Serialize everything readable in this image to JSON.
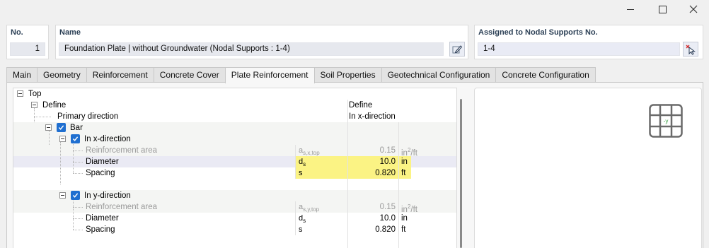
{
  "header": {
    "no": {
      "label": "No.",
      "value": "1"
    },
    "name": {
      "label": "Name",
      "value": "Foundation Plate | without Groundwater (Nodal Supports : 1-4)"
    },
    "assigned": {
      "label": "Assigned to Nodal Supports No.",
      "value": "1-4"
    }
  },
  "tabs": [
    {
      "label": "Main",
      "active": false
    },
    {
      "label": "Geometry",
      "active": false
    },
    {
      "label": "Reinforcement",
      "active": false
    },
    {
      "label": "Concrete Cover",
      "active": false
    },
    {
      "label": "Plate Reinforcement",
      "active": true
    },
    {
      "label": "Soil Properties",
      "active": false
    },
    {
      "label": "Geotechnical Configuration",
      "active": false
    },
    {
      "label": "Concrete Configuration",
      "active": false
    }
  ],
  "tree": {
    "top": "Top",
    "define": {
      "label": "Define",
      "value": "Define"
    },
    "primary_direction": {
      "label": "Primary direction",
      "value": "In x-direction"
    },
    "bar": {
      "label": "Bar",
      "checked": true
    },
    "x_direction": {
      "label": "In x-direction",
      "checked": true,
      "area": {
        "label": "Reinforcement area",
        "symbol": "a",
        "symbol_sub": "s,x,top",
        "value": "0.15",
        "unit": "in",
        "unit_sup": "2",
        "unit_rest": "/ft"
      },
      "diameter": {
        "label": "Diameter",
        "symbol": "d",
        "symbol_sub": "s",
        "value": "10.0",
        "unit": "in"
      },
      "spacing": {
        "label": "Spacing",
        "symbol": "s",
        "value": "0.820",
        "unit": "ft"
      }
    },
    "y_direction": {
      "label": "In y-direction",
      "checked": true,
      "area": {
        "label": "Reinforcement area",
        "symbol": "a",
        "symbol_sub": "s,y,top",
        "value": "0.15",
        "unit": "in",
        "unit_sup": "2",
        "unit_rest": "/ft"
      },
      "diameter": {
        "label": "Diameter",
        "symbol": "d",
        "symbol_sub": "s",
        "value": "10.0",
        "unit": "in"
      },
      "spacing": {
        "label": "Spacing",
        "symbol": "s",
        "value": "0.820",
        "unit": "ft"
      }
    }
  },
  "preview": {
    "axis_label": "-y"
  },
  "colors": {
    "highlight": "#fbf384",
    "checkbox": "#1f6fd0",
    "selected_row": "#eaeaf4",
    "label_text": "#2b3f55"
  },
  "icons": {
    "edit_name": "edit-pencil-icon",
    "select_supports": "pick-cursor-icon",
    "window": [
      "minimize-icon",
      "maximize-icon",
      "close-icon"
    ],
    "preview": "reinforcement-mesh-icon"
  }
}
